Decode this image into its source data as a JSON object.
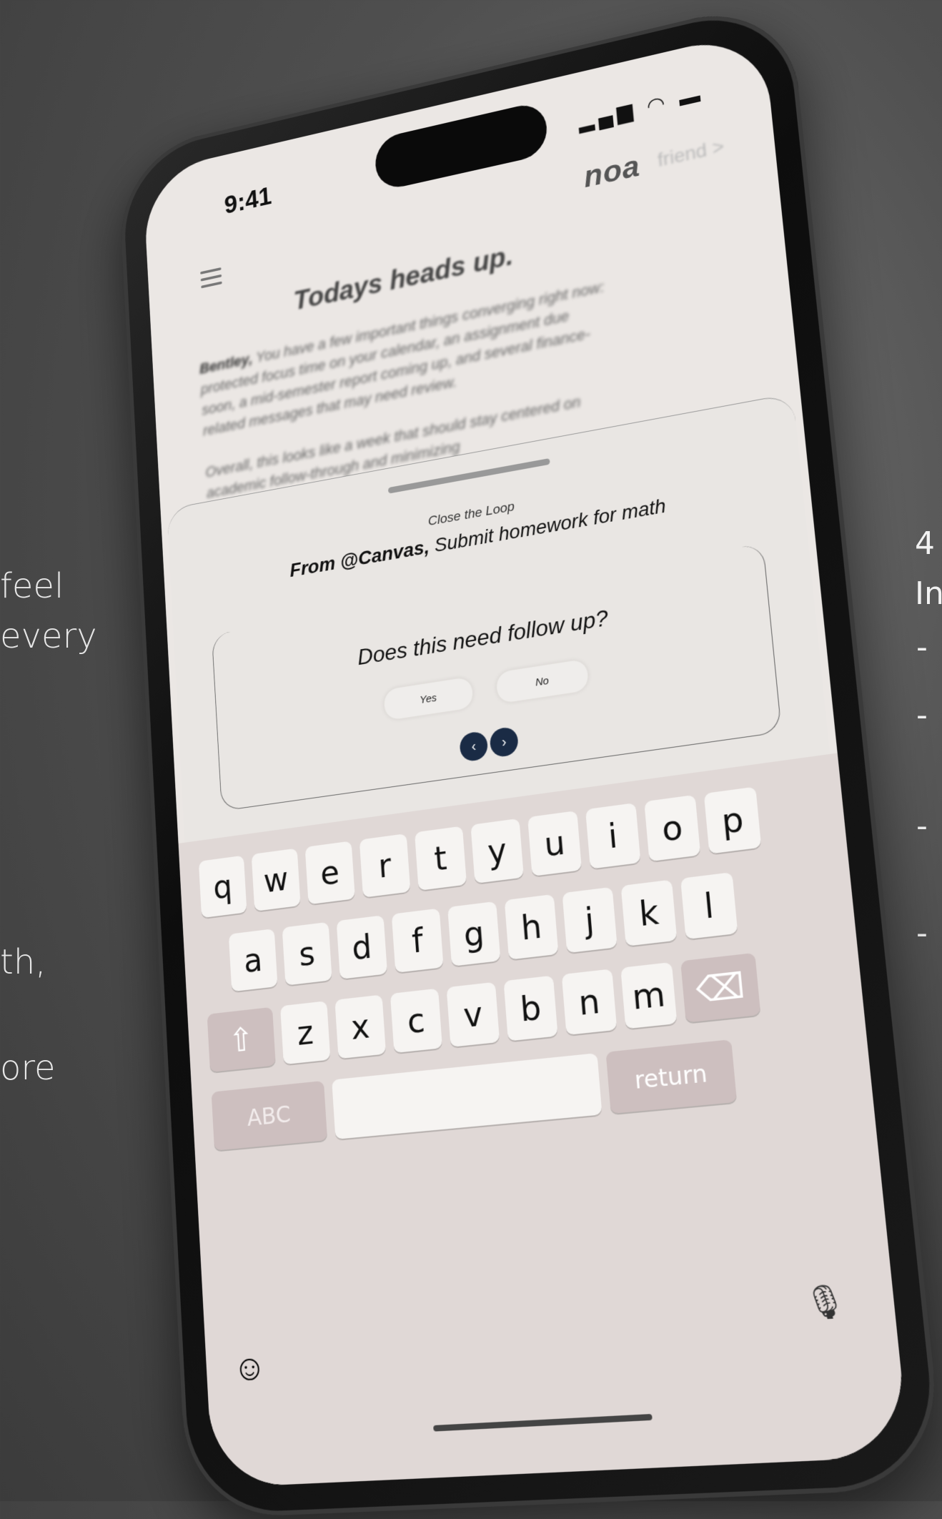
{
  "left_text": {
    "line1": "feel",
    "line2": "every",
    "line3": "th,",
    "line4": "ore"
  },
  "right_text": {
    "line1": "4",
    "line2": "In",
    "dash1": "-",
    "dash2": "-",
    "dash3": "-",
    "dash4": "-"
  },
  "status": {
    "time": "9:41",
    "icons": "signal wifi battery"
  },
  "app": {
    "logo": "noa",
    "logo_sub": "friend >"
  },
  "home": {
    "headline": "Todays heads up.",
    "greeting_name": "Bentley,",
    "paragraph1": "You have a few important things converging right now: protected focus time on your calendar, an assignment due soon, a mid-semester report coming up, and several finance-related messages that may need review.",
    "paragraph2": "Overall, this looks like a week that should stay centered on academic follow-through and minimizing"
  },
  "sheet": {
    "label": "Close the Loop",
    "source": "From @Canvas,",
    "task": "Submit homework for math",
    "question": "Does this need follow up?",
    "yes_label": "Yes",
    "no_label": "No",
    "prev_glyph": "‹",
    "next_glyph": "›"
  },
  "keyboard": {
    "row1": [
      "q",
      "w",
      "e",
      "r",
      "t",
      "y",
      "u",
      "i",
      "o",
      "p"
    ],
    "row2": [
      "a",
      "s",
      "d",
      "f",
      "g",
      "h",
      "j",
      "k",
      "l"
    ],
    "row3": [
      "z",
      "x",
      "c",
      "v",
      "b",
      "n",
      "m"
    ],
    "shift_glyph": "⇧",
    "delete_glyph": "⌫",
    "abc_label": "ABC",
    "return_label": "return",
    "emoji_glyph": "☺",
    "mic_glyph": "🎙"
  }
}
